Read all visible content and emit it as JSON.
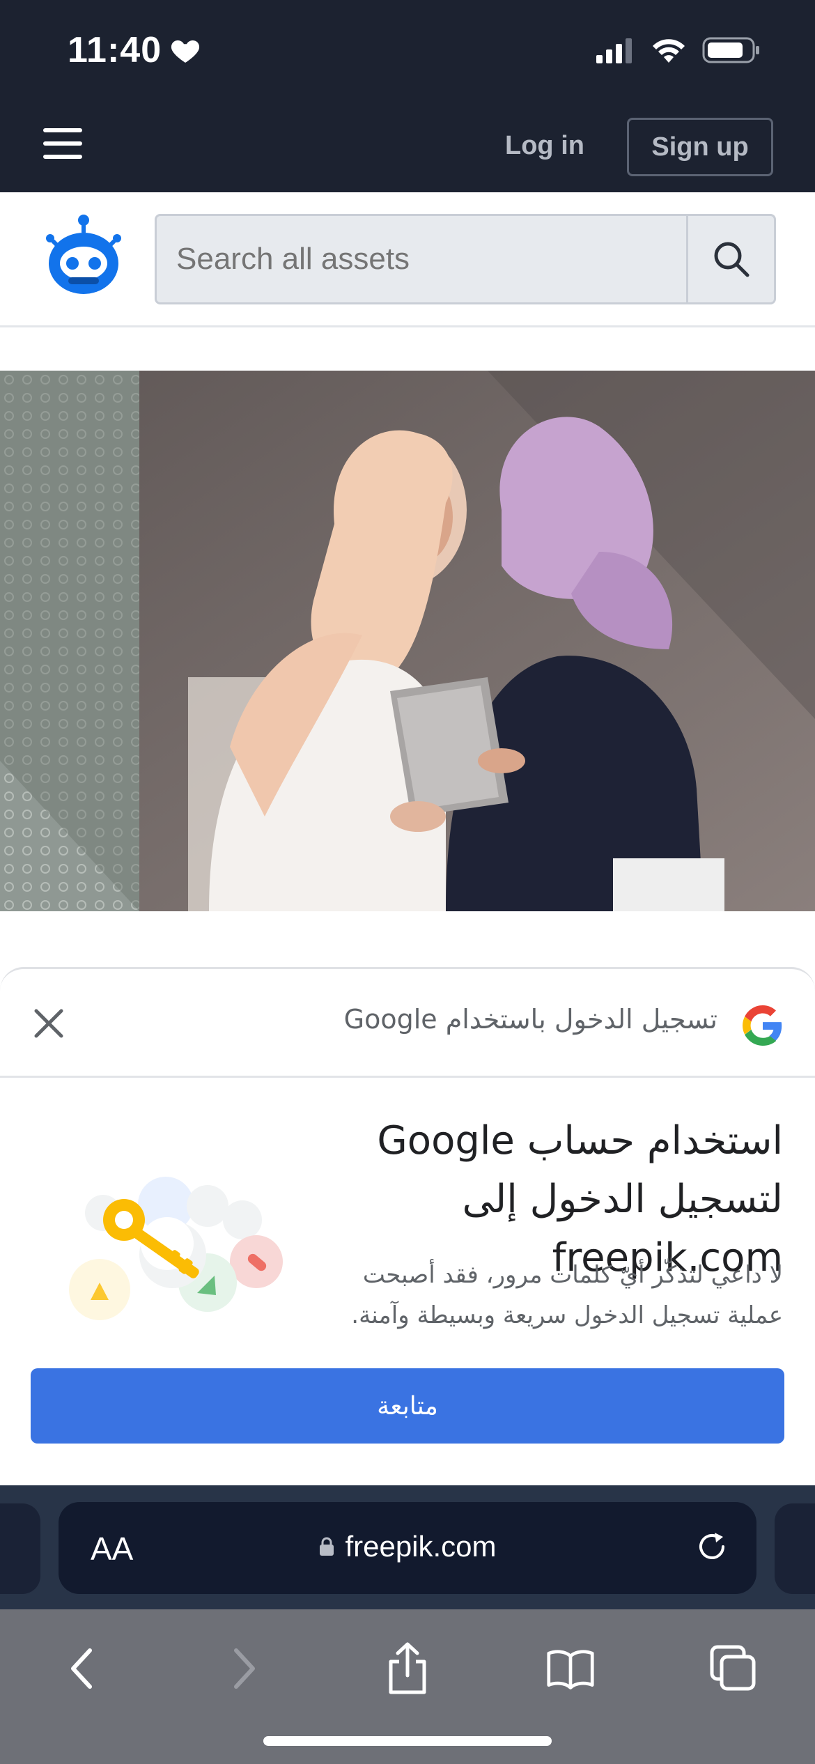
{
  "status_bar": {
    "time": "11:40",
    "icons": [
      "heart-icon",
      "cellular-signal-icon",
      "wifi-icon",
      "battery-icon"
    ]
  },
  "header": {
    "login_label": "Log in",
    "signup_label": "Sign up"
  },
  "search": {
    "placeholder": "Search all assets"
  },
  "google_sheet": {
    "header_title": "تسجيل الدخول باستخدام Google",
    "title": "استخدام حساب Google لتسجيل الدخول إلى freepik.com",
    "subtitle": "لا داعي لتذكّر أيّ كلمات مرور، فقد أصبحت عملية تسجيل الدخول سريعة وبسيطة وآمنة.",
    "continue_label": "متابعة",
    "button_color": "#3a73e2"
  },
  "browser": {
    "text_size_label": "AA",
    "url": "freepik.com"
  },
  "colors": {
    "header_bg": "#1c2230",
    "brand_blue": "#1273eb"
  }
}
